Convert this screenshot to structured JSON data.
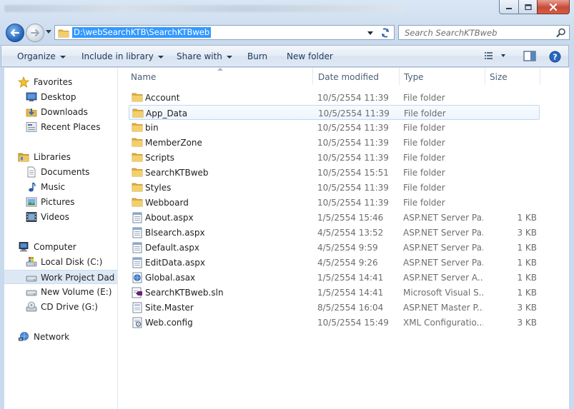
{
  "window": {
    "colors": {
      "accent": "#3399ff",
      "folder": "#e8b84a",
      "close": "#c74a37"
    }
  },
  "nav": {
    "address": "D:\\webSearchKTB\\SearchKTBweb",
    "search_placeholder": "Search SearchKTBweb"
  },
  "toolbar": {
    "organize": "Organize",
    "include": "Include in library",
    "share": "Share with",
    "burn": "Burn",
    "new_folder": "New folder"
  },
  "sidebar": {
    "favorites": "Favorites",
    "desktop": "Desktop",
    "downloads": "Downloads",
    "recent": "Recent Places",
    "libraries": "Libraries",
    "documents": "Documents",
    "music": "Music",
    "pictures": "Pictures",
    "videos": "Videos",
    "computer": "Computer",
    "local_disk": "Local Disk (C:)",
    "work_project": "Work Project Dad (D",
    "new_volume": "New Volume (E:)",
    "cd_drive": "CD Drive (G:)",
    "network": "Network"
  },
  "columns": {
    "name": "Name",
    "date": "Date modified",
    "type": "Type",
    "size": "Size"
  },
  "files": [
    {
      "name": "Account",
      "date": "10/5/2554 11:39",
      "type": "File folder",
      "size": "",
      "icon": "folder-icon"
    },
    {
      "name": "App_Data",
      "date": "10/5/2554 11:39",
      "type": "File folder",
      "size": "",
      "icon": "folder-icon"
    },
    {
      "name": "bin",
      "date": "10/5/2554 11:39",
      "type": "File folder",
      "size": "",
      "icon": "folder-icon"
    },
    {
      "name": "MemberZone",
      "date": "10/5/2554 11:39",
      "type": "File folder",
      "size": "",
      "icon": "folder-icon"
    },
    {
      "name": "Scripts",
      "date": "10/5/2554 11:39",
      "type": "File folder",
      "size": "",
      "icon": "folder-icon"
    },
    {
      "name": "SearchKTBweb",
      "date": "10/5/2554 15:51",
      "type": "File folder",
      "size": "",
      "icon": "folder-icon"
    },
    {
      "name": "Styles",
      "date": "10/5/2554 11:39",
      "type": "File folder",
      "size": "",
      "icon": "folder-icon"
    },
    {
      "name": "Webboard",
      "date": "10/5/2554 11:39",
      "type": "File folder",
      "size": "",
      "icon": "folder-icon"
    },
    {
      "name": "About.aspx",
      "date": "1/5/2554 15:46",
      "type": "ASP.NET Server Pa...",
      "size": "1 KB",
      "icon": "aspx-file-icon"
    },
    {
      "name": "Blsearch.aspx",
      "date": "4/5/2554 13:52",
      "type": "ASP.NET Server Pa...",
      "size": "3 KB",
      "icon": "aspx-file-icon"
    },
    {
      "name": "Default.aspx",
      "date": "4/5/2554 9:59",
      "type": "ASP.NET Server Pa...",
      "size": "1 KB",
      "icon": "aspx-file-icon"
    },
    {
      "name": "EditData.aspx",
      "date": "4/5/2554 9:26",
      "type": "ASP.NET Server Pa...",
      "size": "1 KB",
      "icon": "aspx-file-icon"
    },
    {
      "name": "Global.asax",
      "date": "1/5/2554 14:41",
      "type": "ASP.NET Server A...",
      "size": "1 KB",
      "icon": "asax-file-icon"
    },
    {
      "name": "SearchKTBweb.sln",
      "date": "1/5/2554 14:41",
      "type": "Microsoft Visual S...",
      "size": "1 KB",
      "icon": "sln-file-icon"
    },
    {
      "name": "Site.Master",
      "date": "8/5/2554 16:04",
      "type": "ASP.NET Master P...",
      "size": "3 KB",
      "icon": "master-file-icon"
    },
    {
      "name": "Web.config",
      "date": "10/5/2554 15:49",
      "type": "XML Configuratio...",
      "size": "3 KB",
      "icon": "config-file-icon"
    }
  ]
}
